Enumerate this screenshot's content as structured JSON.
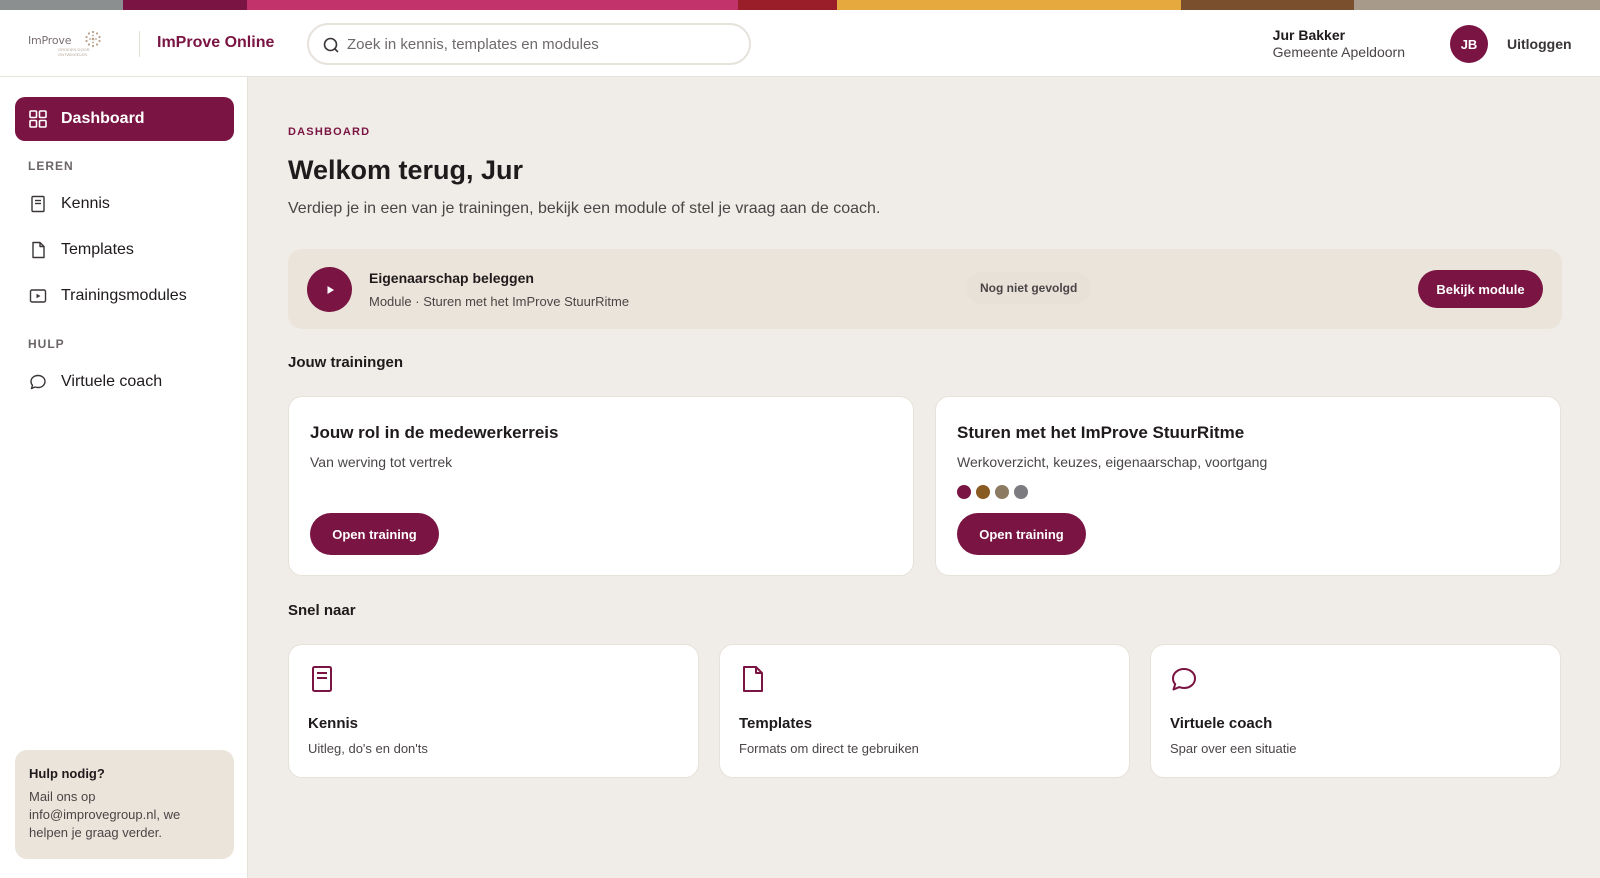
{
  "colors": {
    "accent": "#7a1442",
    "stripe": [
      "#8c8f8f",
      "#7a1442",
      "#c1336a",
      "#9a1e2a",
      "#e6a93d",
      "#7a4f2d",
      "#a89a8a"
    ],
    "dots": [
      "#7a1442",
      "#8a5a23",
      "#8c7a63",
      "#7c7c80"
    ]
  },
  "header": {
    "logo_text": "ImProve",
    "logo_subtext": "GROEIEN DOOR ONTWIKKELEN",
    "brand": "ImProve Online",
    "search_placeholder": "Zoek in kennis, templates en modules",
    "user_name": "Jur Bakker",
    "user_org": "Gemeente Apeldoorn",
    "avatar_initials": "JB",
    "logout": "Uitloggen"
  },
  "sidebar": {
    "dashboard": "Dashboard",
    "section_learn": "LEREN",
    "learn_items": [
      {
        "label": "Kennis",
        "icon": "book-icon"
      },
      {
        "label": "Templates",
        "icon": "document-icon"
      },
      {
        "label": "Trainingsmodules",
        "icon": "play-square-icon"
      }
    ],
    "section_help": "HULP",
    "help_items": [
      {
        "label": "Virtuele coach",
        "icon": "chat-icon"
      }
    ],
    "help_box": {
      "title": "Hulp nodig?",
      "text": "Mail ons op info@improvegroup.nl, we helpen je graag verder."
    }
  },
  "main": {
    "eyebrow": "DASHBOARD",
    "title": "Welkom terug, Jur",
    "subtitle": "Verdiep je in een van je trainingen, bekijk een module of stel je vraag aan de coach.",
    "module": {
      "title": "Eigenaarschap beleggen",
      "subtitle": "Module · Sturen met het ImProve StuurRitme",
      "status": "Nog niet gevolgd",
      "button": "Bekijk module"
    },
    "trainings_heading": "Jouw trainingen",
    "trainings": [
      {
        "title": "Jouw rol in de medewerkerreis",
        "subtitle": "Van werving tot vertrek",
        "button": "Open training"
      },
      {
        "title": "Sturen met het ImProve StuurRitme",
        "subtitle": "Werkoverzicht, keuzes, eigenaarschap, voortgang",
        "button": "Open training"
      }
    ],
    "quick_heading": "Snel naar",
    "quick": [
      {
        "title": "Kennis",
        "subtitle": "Uitleg, do's en don'ts",
        "icon": "book-icon"
      },
      {
        "title": "Templates",
        "subtitle": "Formats om direct te gebruiken",
        "icon": "document-icon"
      },
      {
        "title": "Virtuele coach",
        "subtitle": "Spar over een situatie",
        "icon": "chat-icon"
      }
    ]
  }
}
